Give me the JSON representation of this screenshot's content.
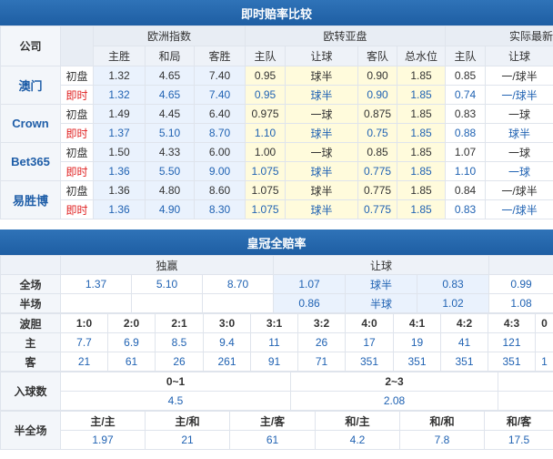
{
  "section1": {
    "title": "即时赔率比较",
    "col_company": "公司",
    "groups": {
      "euro": "欧洲指数",
      "asia": "欧转亚盘",
      "actual": "实际最新"
    },
    "sub": [
      "主胜",
      "和局",
      "客胜",
      "主队",
      "让球",
      "客队",
      "总水位",
      "主队",
      "让球"
    ],
    "init_label": "初盘",
    "live_label": "即时",
    "companies": [
      {
        "name": "澳门",
        "init": [
          "1.32",
          "4.65",
          "7.40",
          "0.95",
          "球半",
          "0.90",
          "1.85",
          "0.85",
          "一/球半"
        ],
        "live": [
          "1.32",
          "4.65",
          "7.40",
          "0.95",
          "球半",
          "0.90",
          "1.85",
          "0.74",
          "一/球半"
        ]
      },
      {
        "name": "Crown",
        "init": [
          "1.49",
          "4.45",
          "6.40",
          "0.975",
          "一球",
          "0.875",
          "1.85",
          "0.83",
          "一球"
        ],
        "live": [
          "1.37",
          "5.10",
          "8.70",
          "1.10",
          "球半",
          "0.75",
          "1.85",
          "0.88",
          "球半"
        ]
      },
      {
        "name": "Bet365",
        "init": [
          "1.50",
          "4.33",
          "6.00",
          "1.00",
          "一球",
          "0.85",
          "1.85",
          "1.07",
          "一球"
        ],
        "live": [
          "1.36",
          "5.50",
          "9.00",
          "1.075",
          "球半",
          "0.775",
          "1.85",
          "1.10",
          "一球"
        ]
      },
      {
        "name": "易胜博",
        "init": [
          "1.36",
          "4.80",
          "8.60",
          "1.075",
          "球半",
          "0.775",
          "1.85",
          "0.84",
          "一/球半"
        ],
        "live": [
          "1.36",
          "4.90",
          "8.30",
          "1.075",
          "球半",
          "0.775",
          "1.85",
          "0.83",
          "一/球半"
        ]
      }
    ]
  },
  "section2": {
    "title": "皇冠全赔率",
    "head_dy": "独赢",
    "head_rq": "让球",
    "full_label": "全场",
    "full": [
      "1.37",
      "5.10",
      "8.70",
      "1.07",
      "球半",
      "0.83",
      "0.99"
    ],
    "half_label": "半场",
    "half": [
      "",
      "",
      "",
      "0.86",
      "半球",
      "1.02",
      "1.08"
    ],
    "bodan_label": "波胆",
    "scores": [
      "1:0",
      "2:0",
      "2:1",
      "3:0",
      "3:1",
      "3:2",
      "4:0",
      "4:1",
      "4:2",
      "4:3",
      "0"
    ],
    "home_label": "主",
    "home": [
      "7.7",
      "6.9",
      "8.5",
      "9.4",
      "11",
      "26",
      "17",
      "19",
      "41",
      "121",
      ""
    ],
    "away_label": "客",
    "away": [
      "21",
      "61",
      "26",
      "261",
      "91",
      "71",
      "351",
      "351",
      "351",
      "351",
      "1"
    ],
    "goals_label": "入球数",
    "goals_heads": [
      "0~1",
      "2~3"
    ],
    "goals_vals": [
      "4.5",
      "2.08"
    ],
    "htft_label": "半全场",
    "htft_heads": [
      "主/主",
      "主/和",
      "主/客",
      "和/主",
      "和/和",
      "和/客"
    ],
    "htft_vals": [
      "1.97",
      "21",
      "61",
      "4.2",
      "7.8",
      "17.5"
    ]
  }
}
